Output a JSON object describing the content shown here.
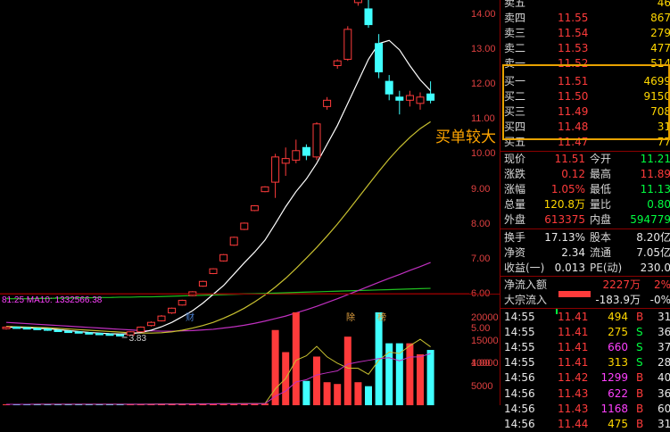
{
  "chart": {
    "price_axis": [
      "14.00",
      "13.00",
      "12.00",
      "11.00",
      "10.00",
      "9.00",
      "8.00",
      "7.00",
      "6.00",
      "5.00",
      "4.00"
    ],
    "volume_axis": [
      "20000",
      "15000",
      "10000",
      "5000"
    ],
    "low_marker": "3.83",
    "ma_legend": "81.25  MA10: 1332566.38",
    "tags": [
      {
        "text": "财",
        "color": "#4a7fd0"
      },
      {
        "text": "除",
        "color": "#e0a040"
      },
      {
        "text": "榜",
        "color": "#e0a040"
      }
    ],
    "callout": "买单较大",
    "colors": {
      "up": "#ff3b3b",
      "down": "#40ffff",
      "ma5": "#ffffff",
      "ma10": "#c8c030",
      "ma20": "#c030c0",
      "ma60": "#20c020"
    }
  },
  "chart_data": {
    "type": "candlestick",
    "candles": [
      {
        "o": 4.05,
        "c": 4.1,
        "h": 4.12,
        "l": 4.02
      },
      {
        "o": 4.1,
        "c": 4.08,
        "h": 4.12,
        "l": 4.05
      },
      {
        "o": 4.08,
        "c": 4.06,
        "h": 4.1,
        "l": 4.04
      },
      {
        "o": 4.06,
        "c": 4.04,
        "h": 4.08,
        "l": 4.02
      },
      {
        "o": 4.04,
        "c": 4.0,
        "h": 4.06,
        "l": 3.98
      },
      {
        "o": 4.0,
        "c": 3.97,
        "h": 4.02,
        "l": 3.95
      },
      {
        "o": 3.97,
        "c": 3.95,
        "h": 3.99,
        "l": 3.93
      },
      {
        "o": 3.95,
        "c": 3.92,
        "h": 3.97,
        "l": 3.9
      },
      {
        "o": 3.92,
        "c": 3.9,
        "h": 3.94,
        "l": 3.88
      },
      {
        "o": 3.9,
        "c": 3.88,
        "h": 3.92,
        "l": 3.86
      },
      {
        "o": 3.88,
        "c": 3.86,
        "h": 3.9,
        "l": 3.85
      },
      {
        "o": 3.86,
        "c": 3.85,
        "h": 3.88,
        "l": 3.83
      },
      {
        "o": 3.85,
        "c": 3.95,
        "h": 3.97,
        "l": 3.84
      },
      {
        "o": 3.95,
        "c": 4.1,
        "h": 4.12,
        "l": 3.94
      },
      {
        "o": 4.15,
        "c": 4.25,
        "h": 4.28,
        "l": 4.12
      },
      {
        "o": 4.3,
        "c": 4.45,
        "h": 4.48,
        "l": 4.28
      },
      {
        "o": 4.55,
        "c": 4.7,
        "h": 4.72,
        "l": 4.52
      },
      {
        "o": 4.8,
        "c": 4.95,
        "h": 4.97,
        "l": 4.78
      },
      {
        "o": 5.1,
        "c": 5.22,
        "h": 5.24,
        "l": 5.08
      },
      {
        "o": 5.4,
        "c": 5.55,
        "h": 5.57,
        "l": 5.38
      },
      {
        "o": 5.8,
        "c": 5.95,
        "h": 5.97,
        "l": 5.78
      },
      {
        "o": 6.2,
        "c": 6.4,
        "h": 6.42,
        "l": 6.18
      },
      {
        "o": 6.7,
        "c": 6.95,
        "h": 6.97,
        "l": 6.68
      },
      {
        "o": 7.2,
        "c": 7.4,
        "h": 7.42,
        "l": 7.18
      },
      {
        "o": 7.8,
        "c": 7.95,
        "h": 7.97,
        "l": 7.78
      },
      {
        "o": 8.4,
        "c": 8.55,
        "h": 8.57,
        "l": 8.38
      },
      {
        "o": 8.7,
        "c": 9.5,
        "h": 9.6,
        "l": 8.2
      },
      {
        "o": 9.3,
        "c": 9.45,
        "h": 9.8,
        "l": 8.9
      },
      {
        "o": 9.4,
        "c": 9.7,
        "h": 10.05,
        "l": 9.3
      },
      {
        "o": 9.8,
        "c": 9.55,
        "h": 9.9,
        "l": 9.4
      },
      {
        "o": 9.5,
        "c": 10.55,
        "h": 10.6,
        "l": 9.4
      },
      {
        "o": 11.1,
        "c": 11.3,
        "h": 11.4,
        "l": 11.0
      },
      {
        "o": 12.4,
        "c": 12.55,
        "h": 12.6,
        "l": 12.3
      },
      {
        "o": 12.6,
        "c": 13.55,
        "h": 13.65,
        "l": 12.55
      },
      {
        "o": 14.4,
        "c": 14.5,
        "h": 14.6,
        "l": 14.3
      },
      {
        "o": 14.2,
        "c": 13.7,
        "h": 14.5,
        "l": 13.6
      },
      {
        "o": 13.1,
        "c": 12.2,
        "h": 13.4,
        "l": 12.0
      },
      {
        "o": 11.9,
        "c": 11.5,
        "h": 12.1,
        "l": 11.3
      },
      {
        "o": 11.4,
        "c": 11.3,
        "h": 11.6,
        "l": 10.85
      },
      {
        "o": 11.3,
        "c": 11.45,
        "h": 11.6,
        "l": 11.1
      },
      {
        "o": 11.2,
        "c": 11.4,
        "h": 11.55,
        "l": 11.0
      },
      {
        "o": 11.5,
        "c": 11.3,
        "h": 11.9,
        "l": 11.2
      }
    ],
    "volume": [
      200,
      220,
      180,
      260,
      240,
      210,
      230,
      250,
      200,
      190,
      210,
      230,
      260,
      280,
      300,
      320,
      300,
      330,
      310,
      350,
      380,
      340,
      360,
      400,
      390,
      420,
      17000,
      12000,
      21000,
      5500,
      11000,
      5200,
      4800,
      15500,
      5200,
      4300,
      21000,
      14000,
      14000,
      14000,
      11500,
      12500
    ],
    "ma5": [
      4.1,
      4.09,
      4.08,
      4.06,
      4.05,
      4.02,
      3.99,
      3.96,
      3.93,
      3.91,
      3.89,
      3.88,
      3.89,
      3.93,
      4.0,
      4.11,
      4.25,
      4.43,
      4.62,
      4.86,
      5.14,
      5.42,
      5.78,
      6.14,
      6.48,
      6.86,
      7.38,
      7.92,
      8.4,
      8.8,
      9.3,
      9.9,
      10.5,
      11.2,
      11.9,
      12.6,
      13.1,
      13.2,
      12.9,
      12.4,
      11.95,
      11.6
    ],
    "ma10": [
      4.12,
      4.11,
      4.1,
      4.09,
      4.08,
      4.06,
      4.04,
      4.02,
      4.0,
      3.98,
      3.96,
      3.94,
      3.92,
      3.91,
      3.91,
      3.92,
      3.95,
      4.0,
      4.07,
      4.15,
      4.25,
      4.38,
      4.53,
      4.7,
      4.9,
      5.12,
      5.37,
      5.65,
      5.96,
      6.29,
      6.63,
      6.99,
      7.37,
      7.78,
      8.2,
      8.62,
      9.04,
      9.44,
      9.8,
      10.12,
      10.4,
      10.62
    ],
    "ma20": [
      4.25,
      4.23,
      4.21,
      4.19,
      4.17,
      4.15,
      4.13,
      4.11,
      4.09,
      4.07,
      4.05,
      4.03,
      4.01,
      3.99,
      3.98,
      3.97,
      3.97,
      3.98,
      3.99,
      4.01,
      4.03,
      4.07,
      4.11,
      4.16,
      4.22,
      4.29,
      4.37,
      4.45,
      4.55,
      4.65,
      4.76,
      4.88,
      5.0,
      5.13,
      5.26,
      5.39,
      5.52,
      5.65,
      5.77,
      5.9,
      6.02,
      6.15
    ],
    "ma60": [
      5.0,
      5.0,
      5.0,
      5.01,
      5.01,
      5.02,
      5.02,
      5.03,
      5.03,
      5.04,
      5.04,
      5.05,
      5.05,
      5.06,
      5.06,
      5.07,
      5.08,
      5.09,
      5.1,
      5.11,
      5.12,
      5.13,
      5.14,
      5.15,
      5.16,
      5.17,
      5.18,
      5.19,
      5.2,
      5.21,
      5.22,
      5.23,
      5.24,
      5.25,
      5.26,
      5.27,
      5.28,
      5.29,
      5.3,
      5.31,
      5.32,
      5.33
    ]
  },
  "orderbook": {
    "asks": [
      {
        "label": "卖五",
        "price": "",
        "vol": "46"
      },
      {
        "label": "卖四",
        "price": "11.55",
        "vol": "867"
      },
      {
        "label": "卖三",
        "price": "11.54",
        "vol": "279"
      },
      {
        "label": "卖二",
        "price": "11.53",
        "vol": "477"
      },
      {
        "label": "卖一",
        "price": "11.52",
        "vol": "514"
      }
    ],
    "bids": [
      {
        "label": "买一",
        "price": "11.51",
        "vol": "4699"
      },
      {
        "label": "买二",
        "price": "11.50",
        "vol": "9150"
      },
      {
        "label": "买三",
        "price": "11.49",
        "vol": "708"
      },
      {
        "label": "买四",
        "price": "11.48",
        "vol": "31"
      },
      {
        "label": "买五",
        "price": "11.47",
        "vol": "77"
      }
    ]
  },
  "stats": [
    {
      "l1": "现价",
      "v1": "11.51",
      "c1": "red",
      "l2": "今开",
      "v2": "11.21",
      "c2": "green"
    },
    {
      "l1": "涨跌",
      "v1": "0.12",
      "c1": "red",
      "l2": "最高",
      "v2": "11.89",
      "c2": "red"
    },
    {
      "l1": "涨幅",
      "v1": "1.05%",
      "c1": "red",
      "l2": "最低",
      "v2": "11.13",
      "c2": "green"
    },
    {
      "l1": "总量",
      "v1": "120.8万",
      "c1": "yellow",
      "l2": "量比",
      "v2": "0.80",
      "c2": "green"
    },
    {
      "l1": "外盘",
      "v1": "613375",
      "c1": "red",
      "l2": "内盘",
      "v2": "594779",
      "c2": "green"
    },
    {
      "l1": "换手",
      "v1": "17.13%",
      "c1": "white",
      "l2": "股本",
      "v2": "8.20亿",
      "c2": "white"
    },
    {
      "l1": "净资",
      "v1": "2.34",
      "c1": "white",
      "l2": "流通",
      "v2": "7.05亿",
      "c2": "white"
    },
    {
      "l1": "收益(一)",
      "v1": "0.013",
      "c1": "white",
      "l2": "PE(动)",
      "v2": "230.0",
      "c2": "white"
    }
  ],
  "flows": [
    {
      "label": "净流入额",
      "value": "2227万",
      "pct": "2%",
      "color": "red"
    },
    {
      "label": "大宗流入",
      "value": "-183.9万",
      "pct": "-0%",
      "color": "white"
    }
  ],
  "ticks": [
    {
      "time": "14:55",
      "price": "11.41",
      "vol": "494",
      "side": "B",
      "extra": "31",
      "vcolor": "yellow"
    },
    {
      "time": "14:55",
      "price": "11.41",
      "vol": "275",
      "side": "S",
      "extra": "36",
      "vcolor": "yellow"
    },
    {
      "time": "14:55",
      "price": "11.41",
      "vol": "660",
      "side": "S",
      "extra": "37",
      "vcolor": "magenta"
    },
    {
      "time": "14:55",
      "price": "11.41",
      "vol": "313",
      "side": "S",
      "extra": "28",
      "vcolor": "yellow"
    },
    {
      "time": "14:56",
      "price": "11.42",
      "vol": "1299",
      "side": "B",
      "extra": "40",
      "vcolor": "magenta"
    },
    {
      "time": "14:56",
      "price": "11.43",
      "vol": "622",
      "side": "B",
      "extra": "36",
      "vcolor": "magenta"
    },
    {
      "time": "14:56",
      "price": "11.43",
      "vol": "1168",
      "side": "B",
      "extra": "60",
      "vcolor": "magenta"
    },
    {
      "time": "14:56",
      "price": "11.44",
      "vol": "475",
      "side": "B",
      "extra": "31",
      "vcolor": "yellow"
    }
  ]
}
